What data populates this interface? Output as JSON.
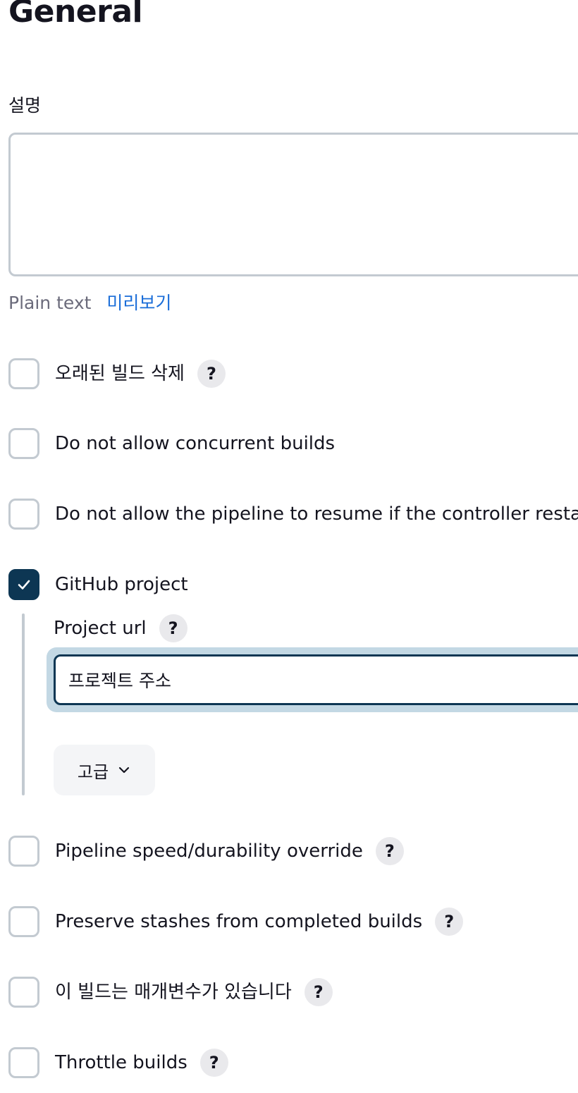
{
  "section": {
    "title": "General"
  },
  "description": {
    "label": "설명",
    "value": "",
    "format_label": "Plain text",
    "preview_link": "미리보기"
  },
  "options": {
    "discard_old_builds": {
      "label": "오래된 빌드 삭제",
      "checked": false,
      "help": "?"
    },
    "no_concurrent_builds": {
      "label": "Do not allow concurrent builds",
      "checked": false
    },
    "no_resume": {
      "label": "Do not allow the pipeline to resume if the controller resta",
      "checked": false
    },
    "github_project": {
      "label": "GitHub project",
      "checked": true
    },
    "pipeline_speed": {
      "label": "Pipeline speed/durability override",
      "checked": false,
      "help": "?"
    },
    "preserve_stashes": {
      "label": "Preserve stashes from completed builds",
      "checked": false,
      "help": "?"
    },
    "parameterized": {
      "label": "이 빌드는 매개변수가 있습니다",
      "checked": false,
      "help": "?"
    },
    "throttle_builds": {
      "label": "Throttle builds",
      "checked": false,
      "help": "?"
    }
  },
  "github": {
    "project_url_label": "Project url",
    "help": "?",
    "project_url_value": "프로젝트 주소",
    "advanced_button": "고급"
  },
  "icons": {
    "check": "check-icon",
    "chevron": "chevron-down-icon",
    "help": "question-mark-icon"
  },
  "colors": {
    "accent": "#0d3653",
    "focus_ring": "#c3d8e4",
    "link": "#1a6dd8",
    "border": "#c3cad1",
    "help_bg": "#e9e9ec"
  }
}
